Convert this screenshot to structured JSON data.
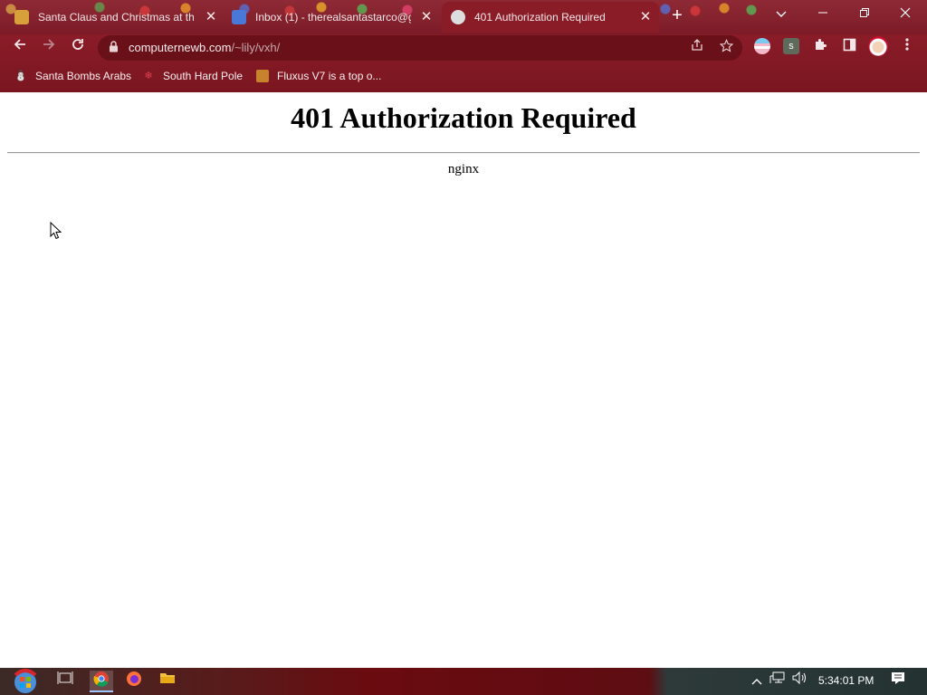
{
  "browser": {
    "tabs": [
      {
        "title": "Santa Claus and Christmas at the",
        "active": false
      },
      {
        "title": "Inbox (1) - therealsantastarco@g",
        "active": false
      },
      {
        "title": "401 Authorization Required",
        "active": true
      }
    ],
    "tab_close_glyph": "✕",
    "new_tab_glyph": "+",
    "address": {
      "domain": "computernewb.com",
      "path": "/~lily/vxh/"
    },
    "bookmarks": [
      {
        "label": "Santa Bombs Arabs",
        "icon": "santa-icon"
      },
      {
        "label": "South Hard Pole",
        "icon": "snowflake-icon"
      },
      {
        "label": "Fluxus V7 is a top o...",
        "icon": "fluxus-icon"
      }
    ],
    "extension_letter": "s",
    "colors": {
      "frame": "#7c1b27",
      "toolbar": "#8a1c28",
      "omnibox": "#6a1019"
    }
  },
  "page": {
    "heading": "401 Authorization Required",
    "server": "nginx"
  },
  "taskbar": {
    "clock": "5:34:01 PM"
  }
}
